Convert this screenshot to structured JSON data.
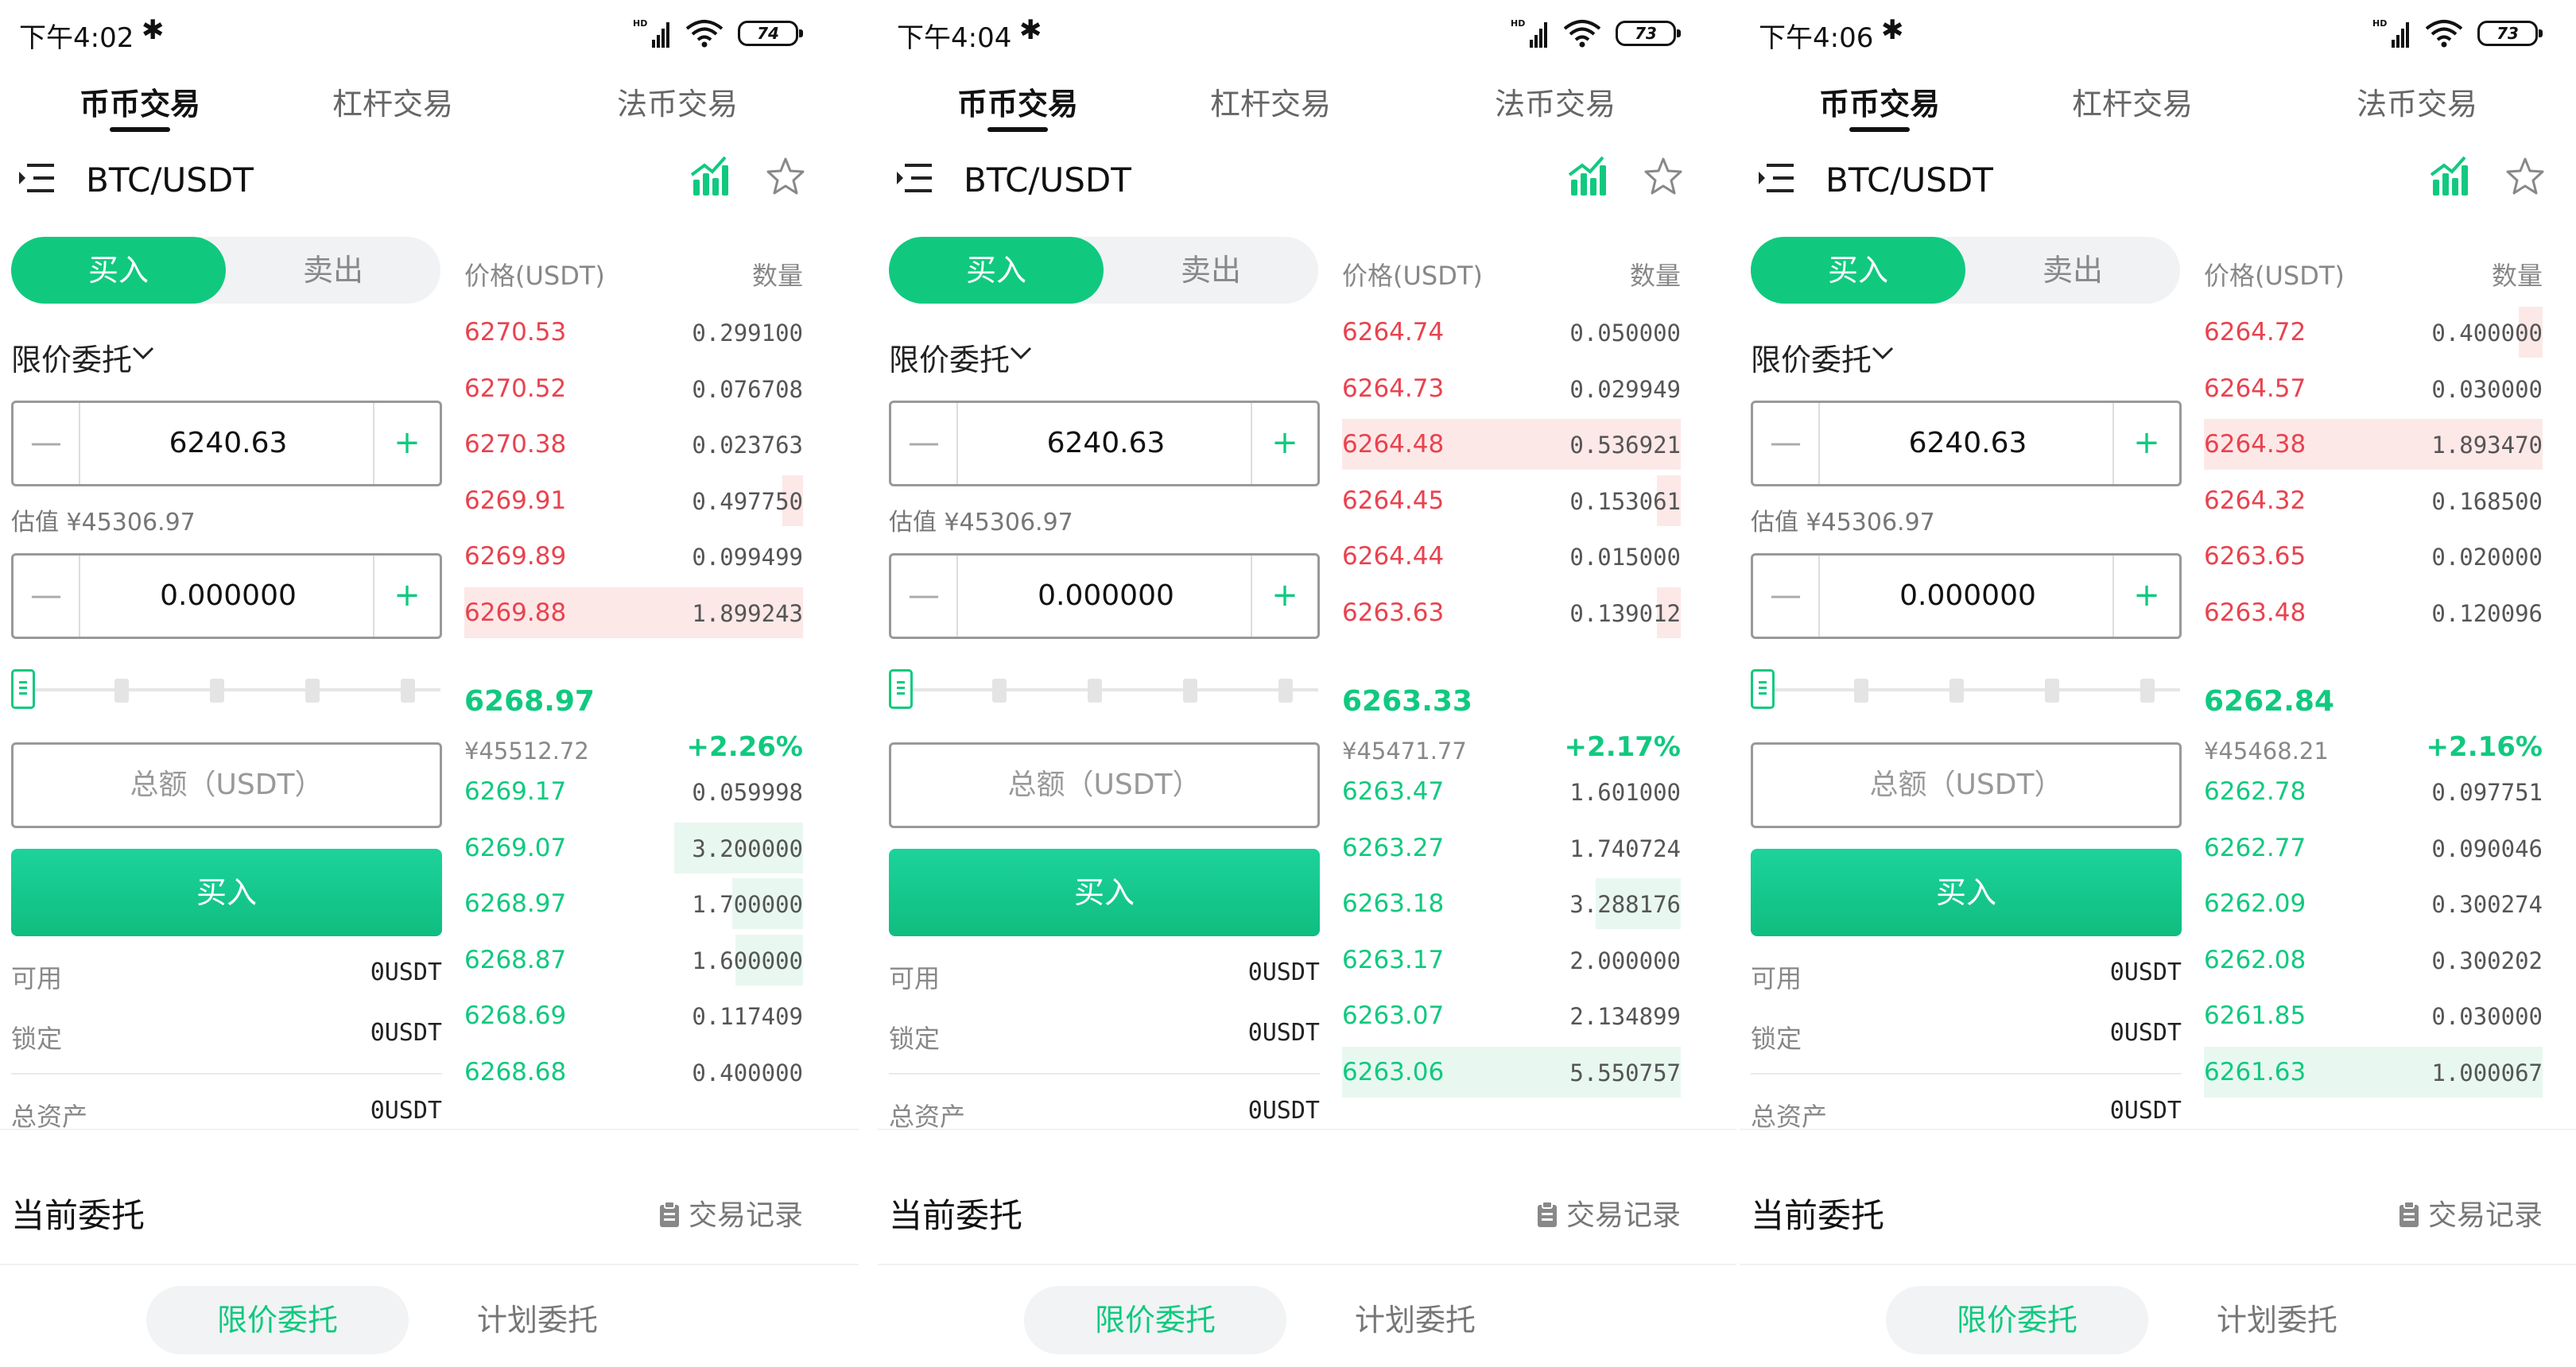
{
  "colors": {
    "accent": "#10c97f",
    "ask": "#e8434f",
    "bid": "#10c97f"
  },
  "panels": [
    {
      "status": {
        "time": "下午4:02",
        "bluetooth": "✱",
        "network": "HD",
        "battery": "74"
      },
      "tabs": [
        "币币交易",
        "杠杆交易",
        "法币交易"
      ],
      "pair": "BTC/USDT",
      "buy_label": "买入",
      "sell_label": "卖出",
      "order_type": "限价委托",
      "price": "6240.63",
      "est": "估值 ¥45306.97",
      "amount": "0.000000",
      "total_placeholder": "总额（USDT）",
      "buy_button": "买入",
      "available_label": "可用",
      "available": "0USDT",
      "locked_label": "锁定",
      "locked": "0USDT",
      "total_assets_label": "总资产",
      "total_assets": "0USDT",
      "ob_price_header": "价格(USDT)",
      "ob_qty_header": "数量",
      "asks": [
        {
          "p": "6270.53",
          "q": "0.299100",
          "depth": 0.0
        },
        {
          "p": "6270.52",
          "q": "0.076708",
          "depth": 0.0
        },
        {
          "p": "6270.38",
          "q": "0.023763",
          "depth": 0.0
        },
        {
          "p": "6269.91",
          "q": "0.497750",
          "depth": 0.06
        },
        {
          "p": "6269.89",
          "q": "0.099499",
          "depth": 0.0
        },
        {
          "p": "6269.88",
          "q": "1.899243",
          "depth": 1.0
        }
      ],
      "last": "6268.97",
      "last_cny": "¥45512.72",
      "change": "+2.26%",
      "bids": [
        {
          "p": "6269.17",
          "q": "0.059998",
          "depth": 0.0
        },
        {
          "p": "6269.07",
          "q": "3.200000",
          "depth": 0.38
        },
        {
          "p": "6268.97",
          "q": "1.700000",
          "depth": 0.21
        },
        {
          "p": "6268.87",
          "q": "1.600000",
          "depth": 0.2
        },
        {
          "p": "6268.69",
          "q": "0.117409",
          "depth": 0.0
        },
        {
          "p": "6268.68",
          "q": "0.400000",
          "depth": 0.0
        }
      ],
      "orders_title": "当前委托",
      "history": "交易记录",
      "subtab_active": "限价委托",
      "subtab_other": "计划委托"
    },
    {
      "status": {
        "time": "下午4:04",
        "bluetooth": "✱",
        "network": "HD",
        "battery": "73"
      },
      "tabs": [
        "币币交易",
        "杠杆交易",
        "法币交易"
      ],
      "pair": "BTC/USDT",
      "buy_label": "买入",
      "sell_label": "卖出",
      "order_type": "限价委托",
      "price": "6240.63",
      "est": "估值 ¥45306.97",
      "amount": "0.000000",
      "total_placeholder": "总额（USDT）",
      "buy_button": "买入",
      "available_label": "可用",
      "available": "0USDT",
      "locked_label": "锁定",
      "locked": "0USDT",
      "total_assets_label": "总资产",
      "total_assets": "0USDT",
      "ob_price_header": "价格(USDT)",
      "ob_qty_header": "数量",
      "asks": [
        {
          "p": "6264.74",
          "q": "0.050000",
          "depth": 0.0
        },
        {
          "p": "6264.73",
          "q": "0.029949",
          "depth": 0.0
        },
        {
          "p": "6264.48",
          "q": "0.536921",
          "depth": 1.0
        },
        {
          "p": "6264.45",
          "q": "0.153061",
          "depth": 0.07
        },
        {
          "p": "6264.44",
          "q": "0.015000",
          "depth": 0.0
        },
        {
          "p": "6263.63",
          "q": "0.139012",
          "depth": 0.07
        }
      ],
      "last": "6263.33",
      "last_cny": "¥45471.77",
      "change": "+2.17%",
      "bids": [
        {
          "p": "6263.47",
          "q": "1.601000",
          "depth": 0.0
        },
        {
          "p": "6263.27",
          "q": "1.740724",
          "depth": 0.0
        },
        {
          "p": "6263.18",
          "q": "3.288176",
          "depth": 0.25
        },
        {
          "p": "6263.17",
          "q": "2.000000",
          "depth": 0.0
        },
        {
          "p": "6263.07",
          "q": "2.134899",
          "depth": 0.0
        },
        {
          "p": "6263.06",
          "q": "5.550757",
          "depth": 1.0
        }
      ],
      "orders_title": "当前委托",
      "history": "交易记录",
      "subtab_active": "限价委托",
      "subtab_other": "计划委托"
    },
    {
      "status": {
        "time": "下午4:06",
        "bluetooth": "✱",
        "network": "HD",
        "battery": "73"
      },
      "tabs": [
        "币币交易",
        "杠杆交易",
        "法币交易"
      ],
      "pair": "BTC/USDT",
      "buy_label": "买入",
      "sell_label": "卖出",
      "order_type": "限价委托",
      "price": "6240.63",
      "est": "估值 ¥45306.97",
      "amount": "0.000000",
      "total_placeholder": "总额（USDT）",
      "buy_button": "买入",
      "available_label": "可用",
      "available": "0USDT",
      "locked_label": "锁定",
      "locked": "0USDT",
      "total_assets_label": "总资产",
      "total_assets": "0USDT",
      "ob_price_header": "价格(USDT)",
      "ob_qty_header": "数量",
      "asks": [
        {
          "p": "6264.72",
          "q": "0.400000",
          "depth": 0.07
        },
        {
          "p": "6264.57",
          "q": "0.030000",
          "depth": 0.0
        },
        {
          "p": "6264.38",
          "q": "1.893470",
          "depth": 1.0
        },
        {
          "p": "6264.32",
          "q": "0.168500",
          "depth": 0.0
        },
        {
          "p": "6263.65",
          "q": "0.020000",
          "depth": 0.0
        },
        {
          "p": "6263.48",
          "q": "0.120096",
          "depth": 0.0
        }
      ],
      "last": "6262.84",
      "last_cny": "¥45468.21",
      "change": "+2.16%",
      "bids": [
        {
          "p": "6262.78",
          "q": "0.097751",
          "depth": 0.0
        },
        {
          "p": "6262.77",
          "q": "0.090046",
          "depth": 0.0
        },
        {
          "p": "6262.09",
          "q": "0.300274",
          "depth": 0.0
        },
        {
          "p": "6262.08",
          "q": "0.300202",
          "depth": 0.0
        },
        {
          "p": "6261.85",
          "q": "0.030000",
          "depth": 0.0
        },
        {
          "p": "6261.63",
          "q": "1.000067",
          "depth": 1.0
        }
      ],
      "orders_title": "当前委托",
      "history": "交易记录",
      "subtab_active": "限价委托",
      "subtab_other": "计划委托"
    }
  ]
}
